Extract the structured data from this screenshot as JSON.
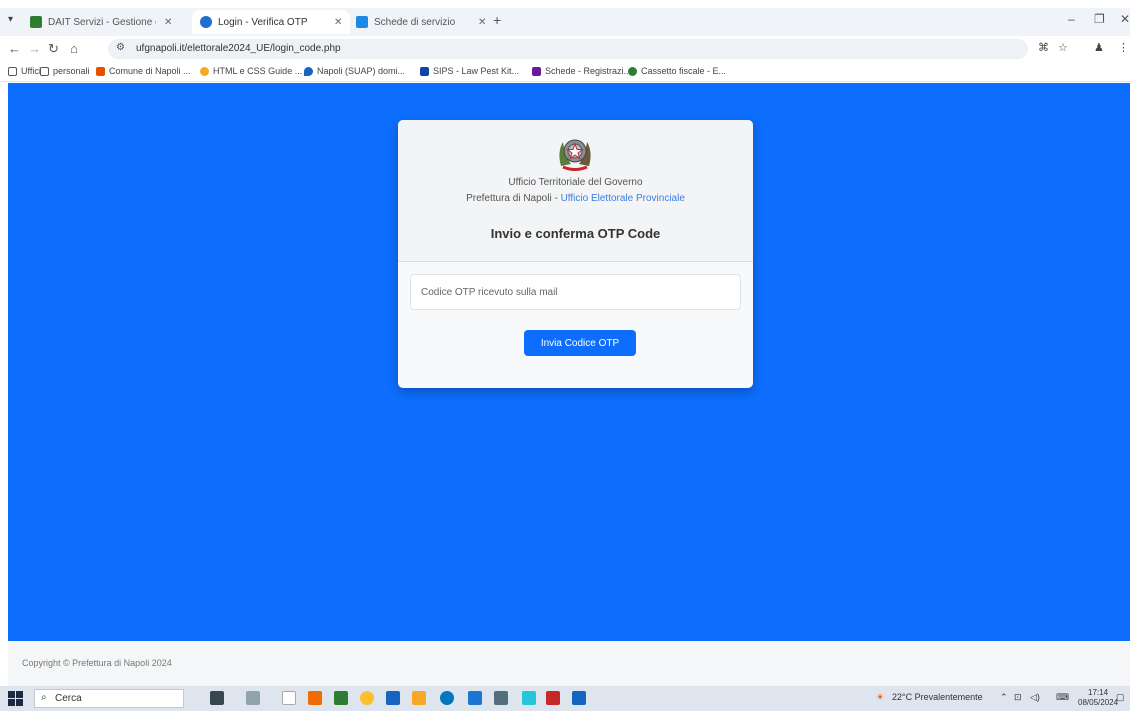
{
  "browser": {
    "tabs": [
      {
        "title": "DAIT Servizi - Gestione elettorale",
        "favicon_color": "#2e7d32",
        "active": false
      },
      {
        "title": "Login - Verifica OTP",
        "favicon_color": "#1f6fd1",
        "active": true
      },
      {
        "title": "Schede di servizio",
        "favicon_color": "#1e88e5",
        "active": false
      }
    ],
    "url": "ufgnapoli.it/elettorale2024_UE/login_code.php",
    "bookmarks": [
      {
        "label": "Uffici",
        "color": "#555555"
      },
      {
        "label": "personali",
        "color": "#555555"
      },
      {
        "label": "Comune di Napoli ...",
        "color": "#e65100"
      },
      {
        "label": "HTML e CSS Guide ...",
        "color": "#f9a825"
      },
      {
        "label": "Napoli (SUAP) domi...",
        "color": "#1565c0"
      },
      {
        "label": "SIPS - Law Pest Kit...",
        "color": "#0d47a1"
      },
      {
        "label": "Schede - Registrazi...",
        "color": "#6a1b9a"
      },
      {
        "label": "Cassetto fiscale - E...",
        "color": "#2e7d32"
      }
    ]
  },
  "card": {
    "org_name": "Ufficio Territoriale del Governo",
    "org_prefix": "Prefettura di Napoli - ",
    "org_link": "Ufficio Elettorale Provinciale",
    "title": "Invio e conferma OTP Code",
    "input_placeholder": "Codice OTP ricevuto sulla mail",
    "button_label": "Invia Codice OTP"
  },
  "footer": {
    "copyright": "Copyright © Prefettura di Napoli 2024"
  },
  "taskbar": {
    "search_label": "Cerca",
    "weather": "22°C Prevalentemente",
    "time": "17:14",
    "date": "08/05/2024"
  },
  "colors": {
    "page_background": "#0d6efd",
    "primary_button": "#0d6efd",
    "link": "#3d7de8"
  }
}
